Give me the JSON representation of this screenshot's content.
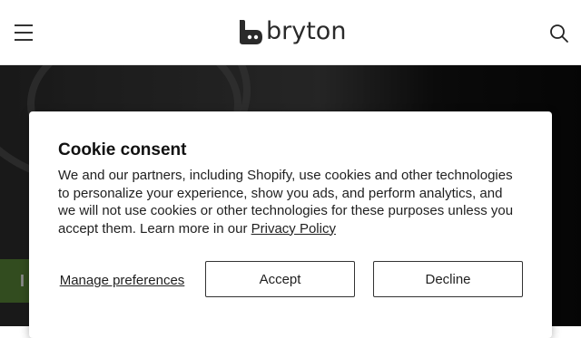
{
  "header": {
    "brand": "bryton",
    "menu_icon": "hamburger-menu-icon",
    "search_icon": "search-icon"
  },
  "hero": {
    "cta_label": "I"
  },
  "cookie": {
    "title": "Cookie consent",
    "body_text": "We and our partners, including Shopify, use cookies and other technologies to personalize your experience, show you ads, and perform analytics, and we will not use cookies or other technologies for these purposes unless you accept them. Learn more in our ",
    "privacy_link": "Privacy Policy",
    "manage_label": "Manage preferences",
    "accept_label": "Accept",
    "decline_label": "Decline"
  },
  "colors": {
    "text": "#1f1f1f",
    "dialog_bg": "#ffffff",
    "cta_green": "#5c8a3a"
  }
}
